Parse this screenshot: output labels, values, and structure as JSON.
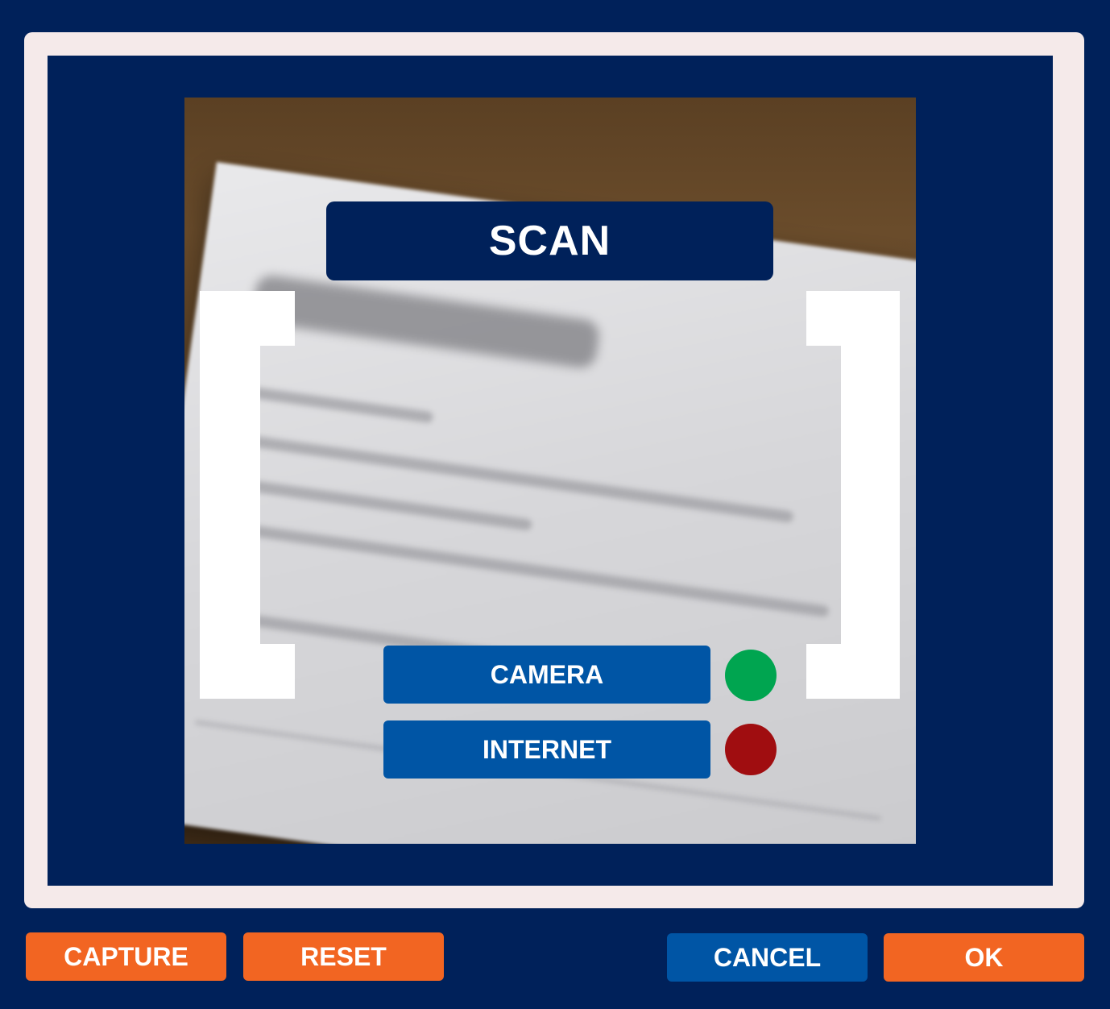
{
  "title": "SCAN",
  "sources": [
    {
      "label": "CAMERA",
      "status": "active",
      "status_color": "#00a550"
    },
    {
      "label": "INTERNET",
      "status": "inactive",
      "status_color": "#a00d10"
    }
  ],
  "actions": {
    "capture_label": "CAPTURE",
    "reset_label": "RESET",
    "cancel_label": "CANCEL",
    "ok_label": "OK"
  },
  "colors": {
    "background": "#00215a",
    "frame": "#f5eaea",
    "primary_button": "#0055a5",
    "accent_button": "#f26522"
  },
  "icons": {
    "camera_status": "status-dot-icon",
    "internet_status": "status-dot-icon"
  }
}
